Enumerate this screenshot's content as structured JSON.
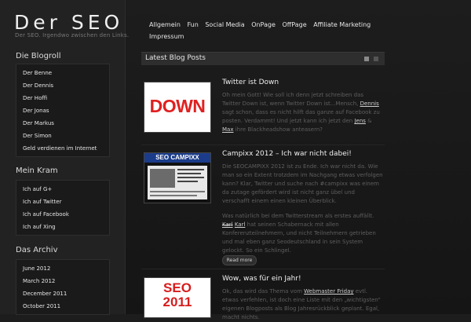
{
  "site": {
    "title": "Der SEO",
    "tagline": "Der SEO. Irgendwo zwischen den Links."
  },
  "nav": [
    "Allgemein",
    "Fun",
    "Social Media",
    "OnPage",
    "OffPage",
    "Affiliate Marketing",
    "Impressum"
  ],
  "sidebar": {
    "blogroll_title": "Die Blogroll",
    "blogroll": [
      "Der Benne",
      "Der Dennis",
      "Der Hoffi",
      "Der Jonas",
      "Der Markus",
      "Der Simon",
      "Geld verdienen im Internet"
    ],
    "mein_kram_title": "Mein Kram",
    "mein_kram": [
      "Ich auf G+",
      "Ich auf Twitter",
      "Ich auf Facebook",
      "Ich auf Xing"
    ],
    "archiv_title": "Das Archiv",
    "archiv": [
      "June 2012",
      "March 2012",
      "December 2011",
      "October 2011"
    ]
  },
  "section": {
    "title": "Latest Blog Posts"
  },
  "posts": [
    {
      "title": "Twitter ist Down",
      "thumb_text": "DOWN",
      "text_1": "Oh mein Gott! Wie soll ich denn jetzt schreiben das Twitter Down ist, wenn Twitter Down ist...Mensch,",
      "link_1": "Dennis",
      "text_2": " sagt schon, dass es nicht hilft das ganze auf Facebook zu posten. Verdammt! Und jetzt kann ich jetzt den",
      "link_2": "Jens",
      "text_3": " &",
      "link_3": "Max",
      "text_4": " ihre Blackheadshow anteasern?"
    },
    {
      "title": "Campixx 2012 – Ich war nicht dabei!",
      "thumb_text": "SEO CAMPIXX",
      "text_1": "Die SEOCAMPIXX 2012 ist zu Ende. Ich war nicht da. Wie man so ein Extent trotzdem im Nachgang etwas verfolgen kann? Klar, Twitter und suche nach #campixx was einem da zutage gefördert wird ist nicht ganz übel und verschafft einem einen kleinen Überblick.",
      "text_2": "Was natürlich bei dem Twitterstream als erstes auffällt.",
      "link_1": "Karl",
      "link_2": "Karl",
      "text_3": " hat seinen Schabernack mit allen Konferenzteilnehmern, und nicht Teilnehmern getrieben und mal eben ganz Seodeutschland in sein System gelockt. So ein Schlingel.",
      "readmore": "Read more"
    },
    {
      "title": "Wow, was für ein Jahr!",
      "thumb_text": "SEO 2011",
      "text_1": "Ok, das wird das Thema vom",
      "link_1": "Webmaster Friday",
      "text_2": " evtl. etwas verfehlen, ist doch eine Liste mit den „wichtigsten“ eigenen Blogposts als Blog Jahresrückblick geplant. Egal, macht nichts."
    }
  ],
  "colors": {
    "background": "#181818",
    "sidebar": "#222222",
    "accent_red": "#e02020"
  }
}
